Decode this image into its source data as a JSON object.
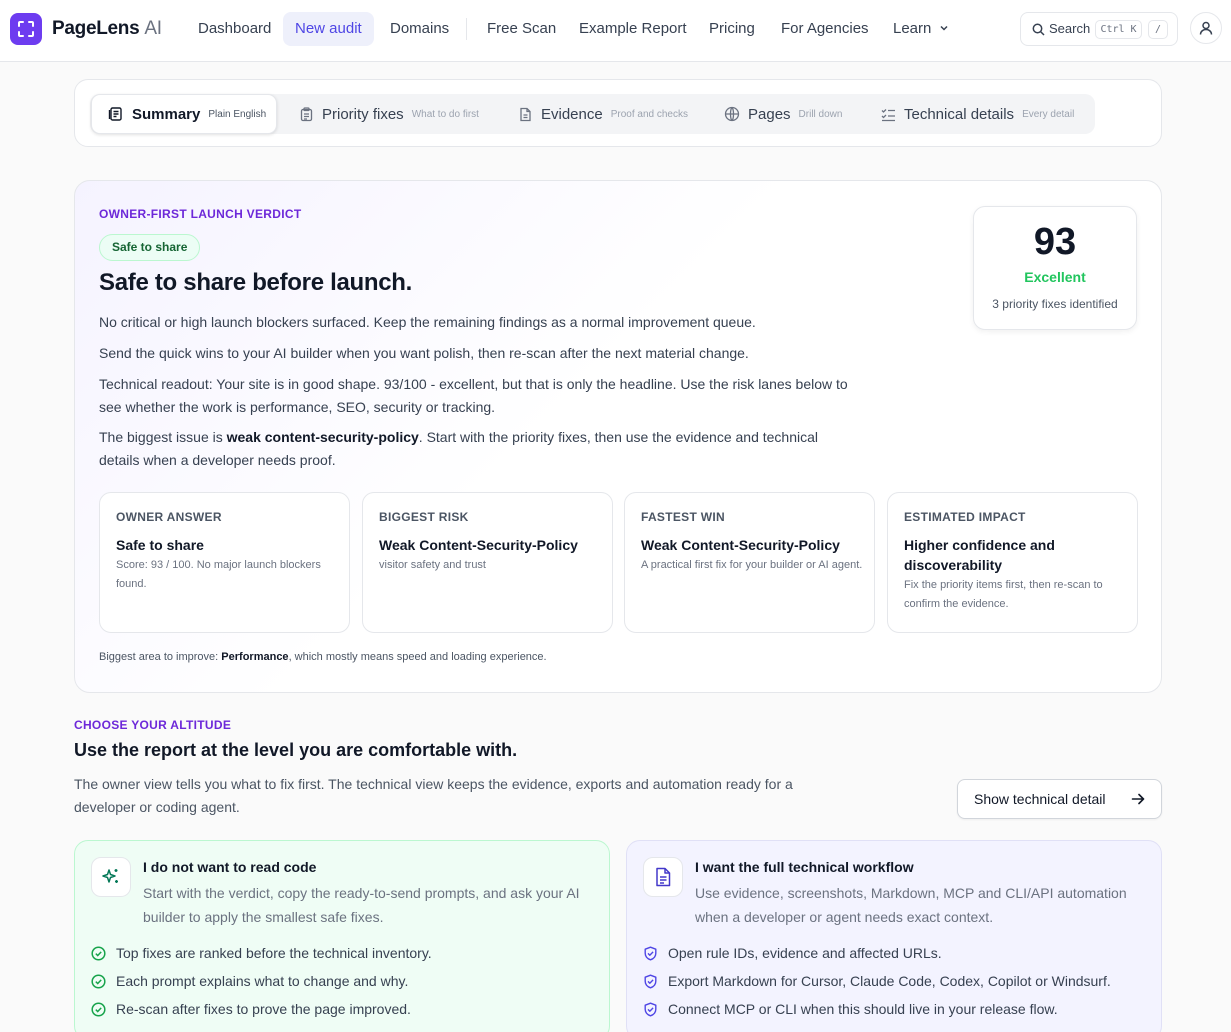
{
  "brand": {
    "name": "PageLens",
    "suffix": "AI"
  },
  "nav": {
    "dashboard": "Dashboard",
    "new_audit": "New audit",
    "domains": "Domains",
    "free_scan": "Free Scan",
    "example_report": "Example Report",
    "pricing": "Pricing",
    "for_agencies": "For Agencies",
    "learn": "Learn"
  },
  "search": {
    "label": "Search",
    "shortcut": "Ctrl K",
    "slash": "/"
  },
  "tabs": [
    {
      "label": "Summary",
      "sub": "Plain English",
      "icon": "summary-icon"
    },
    {
      "label": "Priority fixes",
      "sub": "What to do first",
      "icon": "clipboard-icon"
    },
    {
      "label": "Evidence",
      "sub": "Proof and checks",
      "icon": "file-icon"
    },
    {
      "label": "Pages",
      "sub": "Drill down",
      "icon": "globe-icon"
    },
    {
      "label": "Technical details",
      "sub": "Every detail",
      "icon": "list-check-icon"
    }
  ],
  "verdict": {
    "eyebrow": "OWNER-FIRST LAUNCH VERDICT",
    "pill": "Safe to share",
    "title": "Safe to share before launch.",
    "p1": "No critical or high launch blockers surfaced. Keep the remaining findings as a normal improvement queue.",
    "p2": "Send the quick wins to your AI builder when you want polish, then re-scan after the next material change.",
    "p3": "Technical readout: Your site is in good shape. 93/100 - excellent, but that is only the headline. Use the risk lanes below to see whether the work is performance, SEO, security or tracking.",
    "p4_before": "The biggest issue is ",
    "p4_bold": "weak content-security-policy",
    "p4_after": ". Start with the priority fixes, then use the evidence and technical details when a developer needs proof.",
    "score": "93",
    "grade": "Excellent",
    "score_note": "3 priority fixes identified",
    "cards": [
      {
        "eyebrow": "OWNER ANSWER",
        "title": "Safe to share",
        "text": "Score: 93 / 100. No major launch blockers found."
      },
      {
        "eyebrow": "BIGGEST RISK",
        "title": "Weak Content-Security-Policy",
        "text": "visitor safety and trust"
      },
      {
        "eyebrow": "FASTEST WIN",
        "title": "Weak Content-Security-Policy",
        "text": "A practical first fix for your builder or AI agent."
      },
      {
        "eyebrow": "ESTIMATED IMPACT",
        "title": "Higher confidence and discoverability",
        "text": "Fix the priority items first, then re-scan to confirm the evidence."
      }
    ],
    "area_label": "Biggest area to improve: ",
    "area_bold": "Performance",
    "area_after": ", which mostly means speed and loading experience."
  },
  "altitude": {
    "eyebrow": "CHOOSE YOUR ALTITUDE",
    "title": "Use the report at the level you are comfortable with.",
    "desc": "The owner view tells you what to fix first. The technical view keeps the evidence, exports and automation ready for a developer or coding agent.",
    "button": "Show technical detail",
    "options": [
      {
        "title": "I do not want to read code",
        "desc": "Start with the verdict, copy the ready-to-send prompts, and ask your AI builder to apply the smallest safe fixes.",
        "bullets": [
          "Top fixes are ranked before the technical inventory.",
          "Each prompt explains what to change and why.",
          "Re-scan after fixes to prove the page improved."
        ]
      },
      {
        "title": "I want the full technical workflow",
        "desc": "Use evidence, screenshots, Markdown, MCP and CLI/API automation when a developer or agent needs exact context.",
        "bullets": [
          "Open rule IDs, evidence and affected URLs.",
          "Export Markdown for Cursor, Claude Code, Codex, Copilot or Windsurf.",
          "Connect MCP or CLI when this should live in your release flow."
        ]
      }
    ]
  },
  "colors": {
    "brand": "#6d3cf0",
    "accent": "#4f46e5",
    "eyebrow": "#6d28d9",
    "success": "#22c55e"
  }
}
